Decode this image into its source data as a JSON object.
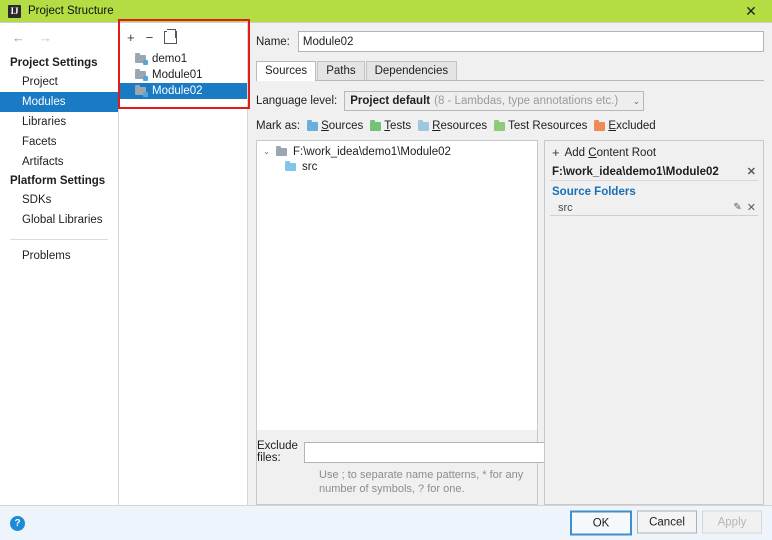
{
  "titlebar": {
    "title": "Project Structure",
    "app_icon": "IJ",
    "close_icon": "✕"
  },
  "nav": {
    "back_icon": "←",
    "forward_icon": "→"
  },
  "sidebar": {
    "groups": [
      {
        "label": "Project Settings",
        "items": [
          {
            "label": "Project",
            "selected": false
          },
          {
            "label": "Modules",
            "selected": true
          },
          {
            "label": "Libraries",
            "selected": false
          },
          {
            "label": "Facets",
            "selected": false
          },
          {
            "label": "Artifacts",
            "selected": false
          }
        ]
      },
      {
        "label": "Platform Settings",
        "items": [
          {
            "label": "SDKs",
            "selected": false
          },
          {
            "label": "Global Libraries",
            "selected": false
          }
        ]
      }
    ],
    "problems_label": "Problems"
  },
  "modules_panel": {
    "toolbar": {
      "add_icon": "+",
      "remove_icon": "−",
      "copy_icon": "copy-icon"
    },
    "items": [
      {
        "label": "demo1",
        "selected": false
      },
      {
        "label": "Module01",
        "selected": false
      },
      {
        "label": "Module02",
        "selected": true
      }
    ]
  },
  "detail": {
    "name_label": "Name:",
    "name_value": "Module02",
    "tabs": [
      {
        "label": "Sources",
        "active": true
      },
      {
        "label": "Paths",
        "active": false
      },
      {
        "label": "Dependencies",
        "active": false
      }
    ],
    "language_level": {
      "label": "Language level:",
      "value": "Project default",
      "hint": "(8 - Lambdas, type annotations etc.)",
      "chevron": "⌄"
    },
    "mark_as": {
      "label": "Mark as:",
      "options": [
        {
          "label": "Sources",
          "accel": "S",
          "color": "#6aaede"
        },
        {
          "label": "Tests",
          "accel": "T",
          "color": "#73c376"
        },
        {
          "label": "Resources",
          "accel": "R",
          "color": "#9fc7e0"
        },
        {
          "label": "Test Resources",
          "accel": "",
          "color": "#8fc97a"
        },
        {
          "label": "Excluded",
          "accel": "E",
          "color": "#ef8b55"
        }
      ]
    },
    "tree": {
      "root": {
        "twisty": "⌄",
        "label": "F:\\work_idea\\demo1\\Module02"
      },
      "children": [
        {
          "label": "src",
          "kind": "source"
        }
      ]
    },
    "exclude": {
      "label": "Exclude files:",
      "value": "",
      "hint": "Use ; to separate name patterns, * for any number of symbols, ? for one."
    }
  },
  "content_root": {
    "add_label_before": "Add ",
    "add_accel": "C",
    "add_label_after": "ontent Root",
    "add_icon": "+",
    "path": "F:\\work_idea\\demo1\\Module02",
    "remove_icon": "✕",
    "source_folders_title": "Source Folders",
    "folders": [
      {
        "name": "src",
        "edit_icon": "✎",
        "remove_icon": "✕"
      }
    ]
  },
  "footer": {
    "help_icon": "?",
    "buttons": [
      {
        "label": "OK",
        "state": "default"
      },
      {
        "label": "Cancel",
        "state": "normal"
      },
      {
        "label": "Apply",
        "state": "disabled"
      }
    ]
  },
  "annotation": {
    "present": true,
    "color": "#e01b1b"
  }
}
